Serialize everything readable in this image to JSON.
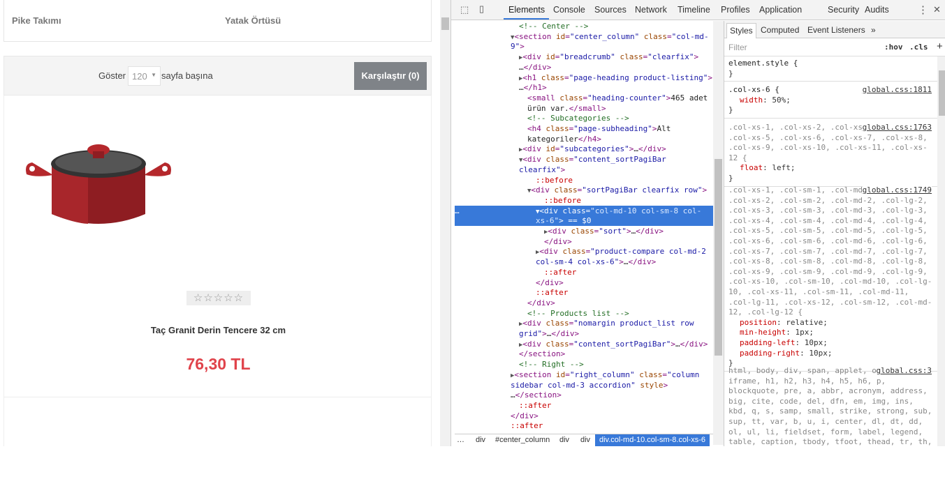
{
  "page": {
    "categories": [
      "Pike Takımı",
      "Yatak Örtüsü"
    ],
    "show_label": "Göster",
    "per_page": "120",
    "per_page_suffix": "sayfa başına",
    "compare_button": "Karşılaştır (0)",
    "product": {
      "title": "Taç Granit Derin Tencere 32 cm",
      "price": "76,30 TL",
      "stars": "☆☆☆☆☆"
    },
    "colors": {
      "price": "#e0434b",
      "accent": "#3879d9"
    }
  },
  "devtools": {
    "tabs": [
      "Elements",
      "Console",
      "Sources",
      "Network",
      "Timeline",
      "Profiles",
      "Application",
      "Security",
      "Audits"
    ],
    "active_tab": "Elements",
    "more_icon": "⋮",
    "close_icon": "✕",
    "tree": [
      [
        [
          "c",
          "<!-- Center -->"
        ]
      ],
      [
        [
          "tri",
          "▼"
        ],
        [
          "t",
          "<section "
        ],
        [
          "a",
          "id"
        ],
        [
          "t",
          "="
        ],
        [
          "v",
          "\"center_column\""
        ],
        [
          "a",
          " class"
        ],
        [
          "t",
          "="
        ],
        [
          "v",
          "\"col-md-"
        ]
      ],
      [
        [
          "v",
          "9\""
        ],
        [
          "t",
          ">"
        ]
      ],
      [
        [
          "tri",
          "▶"
        ],
        [
          "t",
          "<div "
        ],
        [
          "a",
          "id"
        ],
        [
          "t",
          "="
        ],
        [
          "v",
          "\"breadcrumb\""
        ],
        [
          "a",
          " class"
        ],
        [
          "t",
          "="
        ],
        [
          "v",
          "\"clearfix\""
        ],
        [
          "t",
          ">"
        ]
      ],
      [
        [
          "x",
          "…"
        ],
        [
          "t",
          "</div>"
        ]
      ],
      [
        [
          "tri",
          "▶"
        ],
        [
          "t",
          "<h1 "
        ],
        [
          "a",
          "class"
        ],
        [
          "t",
          "="
        ],
        [
          "v",
          "\"page-heading product-listing\""
        ],
        [
          "t",
          ">"
        ]
      ],
      [
        [
          "x",
          "…"
        ],
        [
          "t",
          "</h1>"
        ]
      ],
      [
        [
          "t",
          "<small "
        ],
        [
          "a",
          "class"
        ],
        [
          "t",
          "="
        ],
        [
          "v",
          "\"heading-counter\""
        ],
        [
          "t",
          ">"
        ],
        [
          "x",
          "465 adet"
        ]
      ],
      [
        [
          "x",
          "ürün var."
        ],
        [
          "t",
          "</small>"
        ]
      ],
      [
        [
          "c",
          "<!-- Subcategories -->"
        ]
      ],
      [
        [
          "t",
          "<h4 "
        ],
        [
          "a",
          "class"
        ],
        [
          "t",
          "="
        ],
        [
          "v",
          "\"page-subheading\""
        ],
        [
          "t",
          ">"
        ],
        [
          "x",
          "Alt"
        ]
      ],
      [
        [
          "x",
          "kategoriler"
        ],
        [
          "t",
          "</h4>"
        ]
      ],
      [
        [
          "tri",
          "▶"
        ],
        [
          "t",
          "<div "
        ],
        [
          "a",
          "id"
        ],
        [
          "t",
          "="
        ],
        [
          "v",
          "\"subcategories\""
        ],
        [
          "t",
          ">"
        ],
        [
          "x",
          "…"
        ],
        [
          "t",
          "</div>"
        ]
      ],
      [
        [
          "tri",
          "▼"
        ],
        [
          "t",
          "<div "
        ],
        [
          "a",
          "class"
        ],
        [
          "t",
          "="
        ],
        [
          "v",
          "\"content_sortPagiBar"
        ]
      ],
      [
        [
          "v",
          "clearfix\""
        ],
        [
          "t",
          ">"
        ]
      ],
      [
        [
          "p",
          "::before"
        ]
      ],
      [
        [
          "tri",
          "▼"
        ],
        [
          "t",
          "<div "
        ],
        [
          "a",
          "class"
        ],
        [
          "t",
          "="
        ],
        [
          "v",
          "\"sortPagiBar clearfix row\""
        ],
        [
          "t",
          ">"
        ]
      ],
      [
        [
          "p",
          "::before"
        ]
      ],
      [
        [
          "tri",
          "▼"
        ],
        [
          "t",
          "<div "
        ],
        [
          "a",
          "class"
        ],
        [
          "t",
          "="
        ],
        [
          "v",
          "\"col-md-10 col-sm-8 col-"
        ]
      ],
      [
        [
          "v",
          "xs-6\""
        ],
        [
          "t",
          "> "
        ],
        [
          "m",
          "== $0"
        ]
      ],
      [
        [
          "tri",
          "▶"
        ],
        [
          "t",
          "<div "
        ],
        [
          "a",
          "class"
        ],
        [
          "t",
          "="
        ],
        [
          "v",
          "\"sort\""
        ],
        [
          "t",
          ">"
        ],
        [
          "x",
          "…"
        ],
        [
          "t",
          "</div>"
        ]
      ],
      [
        [
          "t",
          "</div>"
        ]
      ],
      [
        [
          "tri",
          "▶"
        ],
        [
          "t",
          "<div "
        ],
        [
          "a",
          "class"
        ],
        [
          "t",
          "="
        ],
        [
          "v",
          "\"product-compare col-md-2"
        ]
      ],
      [
        [
          "v",
          "col-sm-4 col-xs-6\""
        ],
        [
          "t",
          ">"
        ],
        [
          "x",
          "…"
        ],
        [
          "t",
          "</div>"
        ]
      ],
      [
        [
          "p",
          "::after"
        ]
      ],
      [
        [
          "t",
          "</div>"
        ]
      ],
      [
        [
          "p",
          "::after"
        ]
      ],
      [
        [
          "t",
          "</div>"
        ]
      ],
      [
        [
          "c",
          "<!-- Products list -->"
        ]
      ],
      [
        [
          "tri",
          "▶"
        ],
        [
          "t",
          "<div "
        ],
        [
          "a",
          "class"
        ],
        [
          "t",
          "="
        ],
        [
          "v",
          "\"nomargin product_list row"
        ]
      ],
      [
        [
          "v",
          "grid\""
        ],
        [
          "t",
          ">"
        ],
        [
          "x",
          "…"
        ],
        [
          "t",
          "</div>"
        ]
      ],
      [
        [
          "tri",
          "▶"
        ],
        [
          "t",
          "<div "
        ],
        [
          "a",
          "class"
        ],
        [
          "t",
          "="
        ],
        [
          "v",
          "\"content_sortPagiBar\""
        ],
        [
          "t",
          ">"
        ],
        [
          "x",
          "…"
        ],
        [
          "t",
          "</div>"
        ]
      ],
      [
        [
          "t",
          "</section>"
        ]
      ],
      [
        [
          "c",
          "<!-- Right -->"
        ]
      ],
      [
        [
          "tri",
          "▶"
        ],
        [
          "t",
          "<section "
        ],
        [
          "a",
          "id"
        ],
        [
          "t",
          "="
        ],
        [
          "v",
          "\"right_column\""
        ],
        [
          "a",
          " class"
        ],
        [
          "t",
          "="
        ],
        [
          "v",
          "\"column"
        ]
      ],
      [
        [
          "v",
          "sidebar col-md-3 accordion\""
        ],
        [
          "a",
          " style"
        ],
        [
          "t",
          ">"
        ]
      ],
      [
        [
          "x",
          "…"
        ],
        [
          "t",
          "</section>"
        ]
      ],
      [
        [
          "p",
          "::after"
        ]
      ],
      [
        [
          "t",
          "</div>"
        ]
      ],
      [
        [
          "p",
          "::after"
        ]
      ]
    ],
    "selected_dots": "…",
    "breadcrumbs": [
      "…",
      "div",
      "#center_column",
      "div",
      "div",
      "div.col-md-10.col-sm-8.col-xs-6"
    ],
    "styles": {
      "tabs": [
        "Styles",
        "Computed",
        "Event Listeners",
        "»"
      ],
      "filter_placeholder": "Filter",
      "hov": ":hov",
      "cls": ".cls",
      "add": "+",
      "rules": [
        {
          "selector": "element.style {",
          "src": "",
          "props": [],
          "close": "}"
        },
        {
          "selector": ".col-xs-6 {",
          "src": "global.css:1811",
          "props": [
            [
              "width",
              "50%"
            ]
          ],
          "close": "}"
        },
        {
          "selector": ".col-xs-1, .col-xs-2, .col-xs-3, .col-xs-4, .col-xs-5, .col-xs-6, .col-xs-7, .col-xs-8, .col-xs-9, .col-xs-10, .col-xs-11, .col-xs-12 {",
          "src": "global.css:1763",
          "props": [
            [
              "float",
              "left"
            ]
          ],
          "close": "}"
        },
        {
          "selector": ".col-xs-1, .col-sm-1, .col-md-1, .col-lg-1, .col-xs-2, .col-sm-2, .col-md-2, .col-lg-2, .col-xs-3, .col-sm-3, .col-md-3, .col-lg-3, .col-xs-4, .col-sm-4, .col-md-4, .col-lg-4, .col-xs-5, .col-sm-5, .col-md-5, .col-lg-5, .col-xs-6, .col-sm-6, .col-md-6, .col-lg-6, .col-xs-7, .col-sm-7, .col-md-7, .col-lg-7, .col-xs-8, .col-sm-8, .col-md-8, .col-lg-8, .col-xs-9, .col-sm-9, .col-md-9, .col-lg-9, .col-xs-10, .col-sm-10, .col-md-10, .col-lg-10, .col-xs-11, .col-sm-11, .col-md-11, .col-lg-11, .col-xs-12, .col-sm-12, .col-md-12, .col-lg-12 {",
          "src": "global.css:1749",
          "props": [
            [
              "position",
              "relative"
            ],
            [
              "min-height",
              "1px"
            ],
            [
              "padding-left",
              "10px"
            ],
            [
              "padding-right",
              "10px"
            ]
          ],
          "close": "}"
        },
        {
          "selector": "html, body, div, span, applet, object, iframe, h1, h2, h3, h4, h5, h6, p, blockquote, pre, a, abbr, acronym, address, big, cite, code, del, dfn, em, img, ins, kbd, q, s, samp, small, strike, strong, sub, sup, tt, var, b, u, i, center, dl, dt, dd, ol, ul, li, fieldset, form, label, legend, table, caption, tbody, tfoot, thead, tr, th, td,",
          "src": "global.css:3",
          "props": [],
          "close": ""
        }
      ]
    }
  }
}
